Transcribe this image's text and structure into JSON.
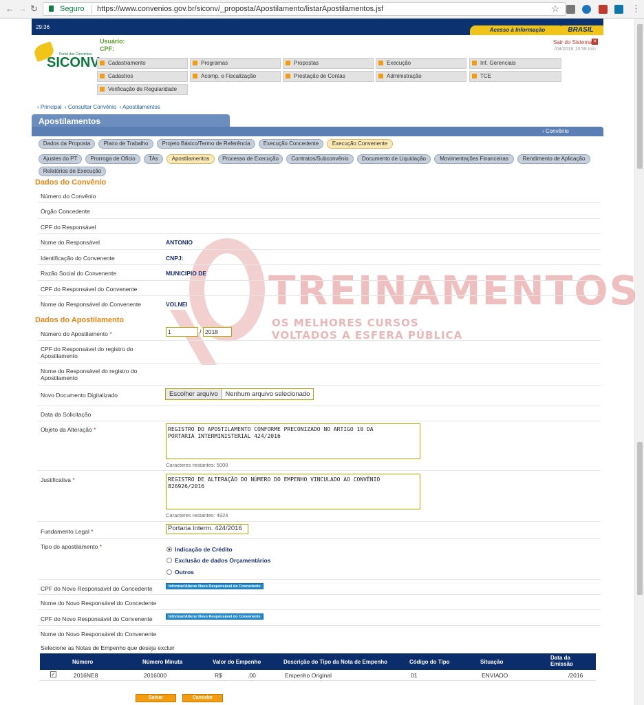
{
  "browser": {
    "back": "←",
    "forward": "→",
    "reload": "↻",
    "secure": "Seguro",
    "url": "https://www.convenios.gov.br/siconv/_proposta/Apostilamento/listarApostilamentos.jsf",
    "star": "☆",
    "menu": "⋮"
  },
  "gov": {
    "time": "29:36",
    "acesso": "Acesso à Informação",
    "brasil": "BRASIL"
  },
  "header": {
    "logo": "SICONV",
    "logo_sub": "Portal dos Convênios",
    "user_label": "Usuário:",
    "cpf_label": "CPF:",
    "sair": "Sair do Sistema",
    "date": "/04/2018 13:58 min"
  },
  "menu": [
    [
      "Cadastramento",
      "Programas",
      "Propostas",
      "Execução",
      "Inf. Gerenciais"
    ],
    [
      "Cadastros",
      "Acomp. e Fiscalização",
      "Prestação de Contas",
      "Administração",
      "TCE"
    ],
    [
      "Verificação de Regularidade"
    ]
  ],
  "breadcrumb": [
    "Principal",
    "Consultar Convênio",
    "Apostilamentos"
  ],
  "page_title": "Apostilamentos",
  "convenio_link": "Convênio",
  "tabs_row1": [
    "Dados da Proposta",
    "Plano de Trabalho",
    "Projeto Básico/Termo de Referência",
    "Execução Concedente",
    "Execução Convenente"
  ],
  "tabs_row2": [
    "Ajustes do PT",
    "Prorroga de Ofício",
    "TAs",
    "Apostilamentos",
    "Processo de Execução",
    "Contratos/Subconvênio",
    "Documento de Liquidação",
    "Movimentações Financeiras",
    "Rendimento de Aplicação"
  ],
  "tabs_row3": [
    "Relatórios de Execução"
  ],
  "convenio": {
    "title": "Dados do Convênio",
    "fields": [
      {
        "label": "Número do Convênio",
        "value": ""
      },
      {
        "label": "Órgão Concedente",
        "value": ""
      },
      {
        "label": "CPF do Responsável",
        "value": ""
      },
      {
        "label": "Nome do Responsável",
        "value": "ANTONIO"
      },
      {
        "label": "Identificação do Convenente",
        "value": "CNPJ:"
      },
      {
        "label": "Razão Social do Convenente",
        "value": "MUNICIPIO DE"
      },
      {
        "label": "CPF do Responsável do Convenente",
        "value": ""
      },
      {
        "label": "Nome do Responsável do Convenente",
        "value": "VOLNEI"
      }
    ]
  },
  "apostilamento": {
    "title": "Dados do Apostilamento",
    "numero_label": "Número do Apostilamento",
    "numero": "1",
    "ano": "2018",
    "slash": "/",
    "cpf_registro_label": "CPF do Responsável do registro do Apostilamento",
    "nome_registro_label": "Nome do Responsável do registro do Apostilamento",
    "doc_label": "Novo Documento Digitalizado",
    "file_btn": "Escolher arquivo",
    "file_none": "Nenhum arquivo selecionado",
    "data_label": "Data da Solicitação",
    "objeto_label": "Objeto da Alteração",
    "objeto": "REGISTRO DO APOSTILAMENTO CONFORME PRECONIZADO NO ARTIGO 10 DA\nPORTARIA INTERMINISTERIAL 424/2016",
    "objeto_chars": "Caracteres restantes: 5000",
    "just_label": "Justificativa",
    "just": "REGISTRO DE ALTERAÇÃO DO NÚMERO DO EMPENHO VINCULADO AO CONVÊNIO\n826926/2016",
    "just_chars": "Caracteres restantes: 4924",
    "fund_label": "Fundamento Legal",
    "fund": "Portaria Interm. 424/2016",
    "tipo_label": "Tipo do apostilamento",
    "tipos": [
      "Indicação de Crédito",
      "Exclusão de dados Orçamentários",
      "Outros"
    ],
    "cpf_conc_label": "CPF do Novo Responsável do Concedente",
    "btn_conc": "Informar/Alterar Novo Responsável do Concedente",
    "nome_conc_label": "Nome do Novo Responsável do Concedente",
    "cpf_conv_label": "CPF do Novo Responsável do Convenente",
    "btn_conv": "Informar/Alterar Novo Responsável do Convenente",
    "nome_conv_label": "Nome do Novo Responsável do Convenente",
    "notas_label": "Selecione as Notas de Empenho que deseja excluir"
  },
  "table": {
    "headers": [
      "Número",
      "Número Minuta",
      "Valor do Empenho",
      "Descrição do Tipo da Nota de Empenho",
      "Código do Tipo",
      "Situação",
      "Data da Emissão"
    ],
    "row": [
      "2016NE8",
      "2016000",
      "R$",
      "Empenho Original",
      "01",
      "ENVIADO",
      "/2016"
    ],
    "valor_cents": ",00"
  },
  "actions": {
    "salvar": "Salvar",
    "cancelar": "Cancelar"
  },
  "watermark": {
    "text": "TREINAMENTOS",
    "sub": "OS MELHORES CURSOS VOLTADOS A ESFERA PÚBLICA"
  }
}
